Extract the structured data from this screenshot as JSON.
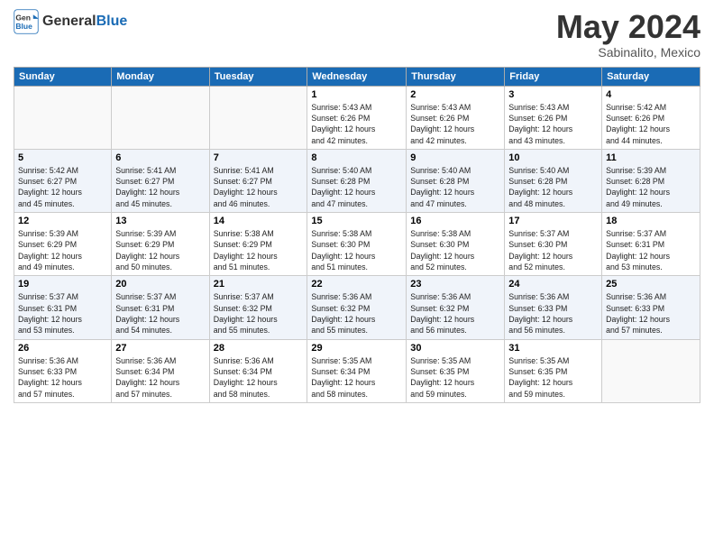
{
  "logo": {
    "general": "General",
    "blue": "Blue"
  },
  "title": "May 2024",
  "subtitle": "Sabinalito, Mexico",
  "days_header": [
    "Sunday",
    "Monday",
    "Tuesday",
    "Wednesday",
    "Thursday",
    "Friday",
    "Saturday"
  ],
  "weeks": [
    [
      {
        "day": "",
        "info": ""
      },
      {
        "day": "",
        "info": ""
      },
      {
        "day": "",
        "info": ""
      },
      {
        "day": "1",
        "info": "Sunrise: 5:43 AM\nSunset: 6:26 PM\nDaylight: 12 hours\nand 42 minutes."
      },
      {
        "day": "2",
        "info": "Sunrise: 5:43 AM\nSunset: 6:26 PM\nDaylight: 12 hours\nand 42 minutes."
      },
      {
        "day": "3",
        "info": "Sunrise: 5:43 AM\nSunset: 6:26 PM\nDaylight: 12 hours\nand 43 minutes."
      },
      {
        "day": "4",
        "info": "Sunrise: 5:42 AM\nSunset: 6:26 PM\nDaylight: 12 hours\nand 44 minutes."
      }
    ],
    [
      {
        "day": "5",
        "info": "Sunrise: 5:42 AM\nSunset: 6:27 PM\nDaylight: 12 hours\nand 45 minutes."
      },
      {
        "day": "6",
        "info": "Sunrise: 5:41 AM\nSunset: 6:27 PM\nDaylight: 12 hours\nand 45 minutes."
      },
      {
        "day": "7",
        "info": "Sunrise: 5:41 AM\nSunset: 6:27 PM\nDaylight: 12 hours\nand 46 minutes."
      },
      {
        "day": "8",
        "info": "Sunrise: 5:40 AM\nSunset: 6:28 PM\nDaylight: 12 hours\nand 47 minutes."
      },
      {
        "day": "9",
        "info": "Sunrise: 5:40 AM\nSunset: 6:28 PM\nDaylight: 12 hours\nand 47 minutes."
      },
      {
        "day": "10",
        "info": "Sunrise: 5:40 AM\nSunset: 6:28 PM\nDaylight: 12 hours\nand 48 minutes."
      },
      {
        "day": "11",
        "info": "Sunrise: 5:39 AM\nSunset: 6:28 PM\nDaylight: 12 hours\nand 49 minutes."
      }
    ],
    [
      {
        "day": "12",
        "info": "Sunrise: 5:39 AM\nSunset: 6:29 PM\nDaylight: 12 hours\nand 49 minutes."
      },
      {
        "day": "13",
        "info": "Sunrise: 5:39 AM\nSunset: 6:29 PM\nDaylight: 12 hours\nand 50 minutes."
      },
      {
        "day": "14",
        "info": "Sunrise: 5:38 AM\nSunset: 6:29 PM\nDaylight: 12 hours\nand 51 minutes."
      },
      {
        "day": "15",
        "info": "Sunrise: 5:38 AM\nSunset: 6:30 PM\nDaylight: 12 hours\nand 51 minutes."
      },
      {
        "day": "16",
        "info": "Sunrise: 5:38 AM\nSunset: 6:30 PM\nDaylight: 12 hours\nand 52 minutes."
      },
      {
        "day": "17",
        "info": "Sunrise: 5:37 AM\nSunset: 6:30 PM\nDaylight: 12 hours\nand 52 minutes."
      },
      {
        "day": "18",
        "info": "Sunrise: 5:37 AM\nSunset: 6:31 PM\nDaylight: 12 hours\nand 53 minutes."
      }
    ],
    [
      {
        "day": "19",
        "info": "Sunrise: 5:37 AM\nSunset: 6:31 PM\nDaylight: 12 hours\nand 53 minutes."
      },
      {
        "day": "20",
        "info": "Sunrise: 5:37 AM\nSunset: 6:31 PM\nDaylight: 12 hours\nand 54 minutes."
      },
      {
        "day": "21",
        "info": "Sunrise: 5:37 AM\nSunset: 6:32 PM\nDaylight: 12 hours\nand 55 minutes."
      },
      {
        "day": "22",
        "info": "Sunrise: 5:36 AM\nSunset: 6:32 PM\nDaylight: 12 hours\nand 55 minutes."
      },
      {
        "day": "23",
        "info": "Sunrise: 5:36 AM\nSunset: 6:32 PM\nDaylight: 12 hours\nand 56 minutes."
      },
      {
        "day": "24",
        "info": "Sunrise: 5:36 AM\nSunset: 6:33 PM\nDaylight: 12 hours\nand 56 minutes."
      },
      {
        "day": "25",
        "info": "Sunrise: 5:36 AM\nSunset: 6:33 PM\nDaylight: 12 hours\nand 57 minutes."
      }
    ],
    [
      {
        "day": "26",
        "info": "Sunrise: 5:36 AM\nSunset: 6:33 PM\nDaylight: 12 hours\nand 57 minutes."
      },
      {
        "day": "27",
        "info": "Sunrise: 5:36 AM\nSunset: 6:34 PM\nDaylight: 12 hours\nand 57 minutes."
      },
      {
        "day": "28",
        "info": "Sunrise: 5:36 AM\nSunset: 6:34 PM\nDaylight: 12 hours\nand 58 minutes."
      },
      {
        "day": "29",
        "info": "Sunrise: 5:35 AM\nSunset: 6:34 PM\nDaylight: 12 hours\nand 58 minutes."
      },
      {
        "day": "30",
        "info": "Sunrise: 5:35 AM\nSunset: 6:35 PM\nDaylight: 12 hours\nand 59 minutes."
      },
      {
        "day": "31",
        "info": "Sunrise: 5:35 AM\nSunset: 6:35 PM\nDaylight: 12 hours\nand 59 minutes."
      },
      {
        "day": "",
        "info": ""
      }
    ]
  ]
}
